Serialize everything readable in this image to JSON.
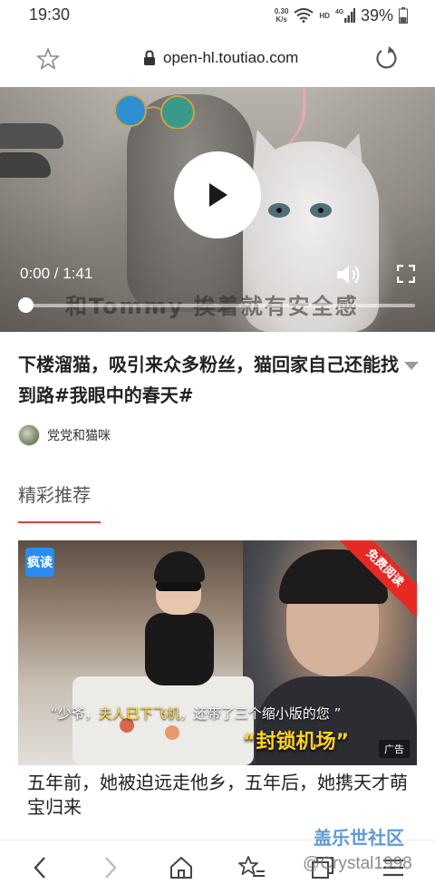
{
  "status_bar": {
    "time": "19:30",
    "net_speed_value": "0.30",
    "net_speed_unit": "K/s",
    "network_label": "HD",
    "network_type": "4G",
    "battery": "39%"
  },
  "browser": {
    "url": "open-hl.toutiao.com"
  },
  "video": {
    "time_display": "0:00 / 1:41",
    "subtitle": "和Tommy 挨着就有安全感",
    "progress_fraction": 0.0
  },
  "article": {
    "title": "下楼溜猫，吸引来众多粉丝，猫回家自己还能找到路#我眼中的春天#",
    "author": "党党和猫咪"
  },
  "recommend": {
    "section_title": "精彩推荐"
  },
  "ad": {
    "logo_text": "疯读",
    "ribbon": "免费阅读",
    "caption_part1": "“少爷，",
    "caption_highlight": "夫人已下飞机",
    "caption_part2": "，还带了三个缩小版的您 ”",
    "headline": "“封锁机场”",
    "badge": "广告",
    "title": "五年前，她被迫远走他乡，五年后，她携天才萌宝归来"
  },
  "watermark": {
    "brand": "盖乐世社区",
    "user": "@Crystal1998"
  },
  "colors": {
    "accent_red": "#e0403a",
    "ad_ribbon_red": "#e52a23",
    "caption_yellow": "#ffd62e"
  },
  "icons": {
    "bookmark": "star-outline",
    "lock": "lock",
    "reload": "reload",
    "play": "play-triangle",
    "volume": "speaker",
    "fullscreen": "expand-corners",
    "nav_back": "chevron-left",
    "nav_forward": "chevron-right",
    "nav_home": "home",
    "nav_bookmarks": "star-list",
    "nav_tabs": "tabs",
    "nav_menu": "hamburger"
  }
}
